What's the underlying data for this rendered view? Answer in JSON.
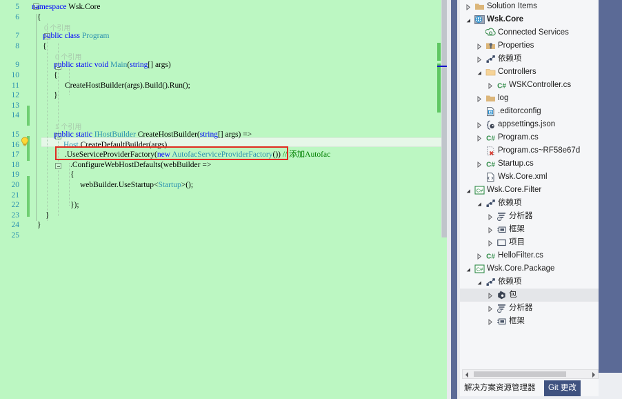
{
  "editor": {
    "background_color": "#bcf7c2",
    "line_number_color": "#2b91af",
    "first_line": 5,
    "last_line": 25,
    "lines": [
      {
        "num": "5",
        "text": "namespace Wsk.Core"
      },
      {
        "num": "6",
        "text": "{"
      },
      {
        "num": "7",
        "text": "public class Program"
      },
      {
        "num": "8",
        "text": "{"
      },
      {
        "num": "9",
        "text": "public static void Main(string[] args)"
      },
      {
        "num": "10",
        "text": "{"
      },
      {
        "num": "11",
        "text": "CreateHostBuilder(args).Build().Run();"
      },
      {
        "num": "12",
        "text": "}"
      },
      {
        "num": "13",
        "text": ""
      },
      {
        "num": "14",
        "text": ""
      },
      {
        "num": "15",
        "text": "public static IHostBuilder CreateHostBuilder(string[] args) =>"
      },
      {
        "num": "16",
        "text": "Host.CreateDefaultBuilder(args)"
      },
      {
        "num": "17",
        "text": ".UseServiceProviderFactory(new AutofacServiceProviderFactory()) // 添加Autofac"
      },
      {
        "num": "18",
        "text": ".ConfigureWebHostDefaults(webBuilder =>"
      },
      {
        "num": "19",
        "text": "{"
      },
      {
        "num": "20",
        "text": "webBuilder.UseStartup<Startup>();"
      },
      {
        "num": "21",
        "text": ""
      },
      {
        "num": "22",
        "text": "});"
      },
      {
        "num": "23",
        "text": "}"
      },
      {
        "num": "24",
        "text": "}"
      },
      {
        "num": "25",
        "text": ""
      }
    ],
    "codelens": [
      {
        "after_line": "6",
        "text": "0 个引用"
      },
      {
        "after_line": "8",
        "text": "0 个引用"
      },
      {
        "after_line": "14",
        "text": "1 个引用"
      }
    ],
    "highlight_comment": "// 添加Autofac",
    "annotation_box_line": "17",
    "annotation_box_color": "#e02b20",
    "current_line": "16"
  },
  "solution_explorer": {
    "tree": [
      {
        "indent": 0,
        "twisty": "collapsed",
        "icon": "folder-icon",
        "label": "Solution Items",
        "bold": false,
        "selected": false
      },
      {
        "indent": 0,
        "twisty": "expanded",
        "icon": "web-project-icon",
        "label": "Wsk.Core",
        "bold": true,
        "selected": false
      },
      {
        "indent": 1,
        "twisty": "none",
        "icon": "connected-services-icon",
        "label": "Connected Services",
        "bold": false,
        "selected": false
      },
      {
        "indent": 1,
        "twisty": "collapsed",
        "icon": "properties-icon",
        "label": "Properties",
        "bold": false,
        "selected": false
      },
      {
        "indent": 1,
        "twisty": "collapsed",
        "icon": "dependencies-icon",
        "label": "依赖项",
        "bold": false,
        "selected": false
      },
      {
        "indent": 1,
        "twisty": "expanded",
        "icon": "folder-open-icon",
        "label": "Controllers",
        "bold": false,
        "selected": false
      },
      {
        "indent": 2,
        "twisty": "collapsed",
        "icon": "csharp-file-icon",
        "label": "WSKController.cs",
        "bold": false,
        "selected": false
      },
      {
        "indent": 1,
        "twisty": "collapsed",
        "icon": "folder-icon",
        "label": "log",
        "bold": false,
        "selected": false
      },
      {
        "indent": 1,
        "twisty": "none",
        "icon": "editorconfig-icon",
        "label": ".editorconfig",
        "bold": false,
        "selected": false
      },
      {
        "indent": 1,
        "twisty": "collapsed",
        "icon": "json-file-icon",
        "label": "appsettings.json",
        "bold": false,
        "selected": false
      },
      {
        "indent": 1,
        "twisty": "collapsed",
        "icon": "csharp-file-icon",
        "label": "Program.cs",
        "bold": false,
        "selected": false
      },
      {
        "indent": 1,
        "twisty": "none",
        "icon": "excluded-file-icon",
        "label": "Program.cs~RF58e67d",
        "bold": false,
        "selected": false
      },
      {
        "indent": 1,
        "twisty": "collapsed",
        "icon": "csharp-file-icon",
        "label": "Startup.cs",
        "bold": false,
        "selected": false
      },
      {
        "indent": 1,
        "twisty": "none",
        "icon": "xml-file-icon",
        "label": "Wsk.Core.xml",
        "bold": false,
        "selected": false
      },
      {
        "indent": 0,
        "twisty": "expanded",
        "icon": "csharp-project-icon",
        "label": "Wsk.Core.Filter",
        "bold": false,
        "selected": false
      },
      {
        "indent": 1,
        "twisty": "expanded",
        "icon": "dependencies-icon",
        "label": "依赖项",
        "bold": false,
        "selected": false
      },
      {
        "indent": 2,
        "twisty": "collapsed",
        "icon": "analyzers-icon",
        "label": "分析器",
        "bold": false,
        "selected": false
      },
      {
        "indent": 2,
        "twisty": "collapsed",
        "icon": "framework-icon",
        "label": "框架",
        "bold": false,
        "selected": false
      },
      {
        "indent": 2,
        "twisty": "collapsed",
        "icon": "projects-icon",
        "label": "项目",
        "bold": false,
        "selected": false
      },
      {
        "indent": 1,
        "twisty": "collapsed",
        "icon": "csharp-file-icon",
        "label": "HelloFilter.cs",
        "bold": false,
        "selected": false
      },
      {
        "indent": 0,
        "twisty": "expanded",
        "icon": "csharp-project-icon",
        "label": "Wsk.Core.Package",
        "bold": false,
        "selected": false
      },
      {
        "indent": 1,
        "twisty": "expanded",
        "icon": "dependencies-icon",
        "label": "依赖项",
        "bold": false,
        "selected": false
      },
      {
        "indent": 2,
        "twisty": "collapsed",
        "icon": "packages-icon",
        "label": "包",
        "bold": false,
        "selected": true
      },
      {
        "indent": 2,
        "twisty": "collapsed",
        "icon": "analyzers-icon",
        "label": "分析器",
        "bold": false,
        "selected": false
      },
      {
        "indent": 2,
        "twisty": "collapsed",
        "icon": "framework-icon",
        "label": "框架",
        "bold": false,
        "selected": false
      }
    ],
    "tabs": [
      {
        "label": "解决方案资源管理器",
        "active": false
      },
      {
        "label": "Git 更改",
        "active": true
      }
    ],
    "active_tab_color": "#3f5280"
  }
}
